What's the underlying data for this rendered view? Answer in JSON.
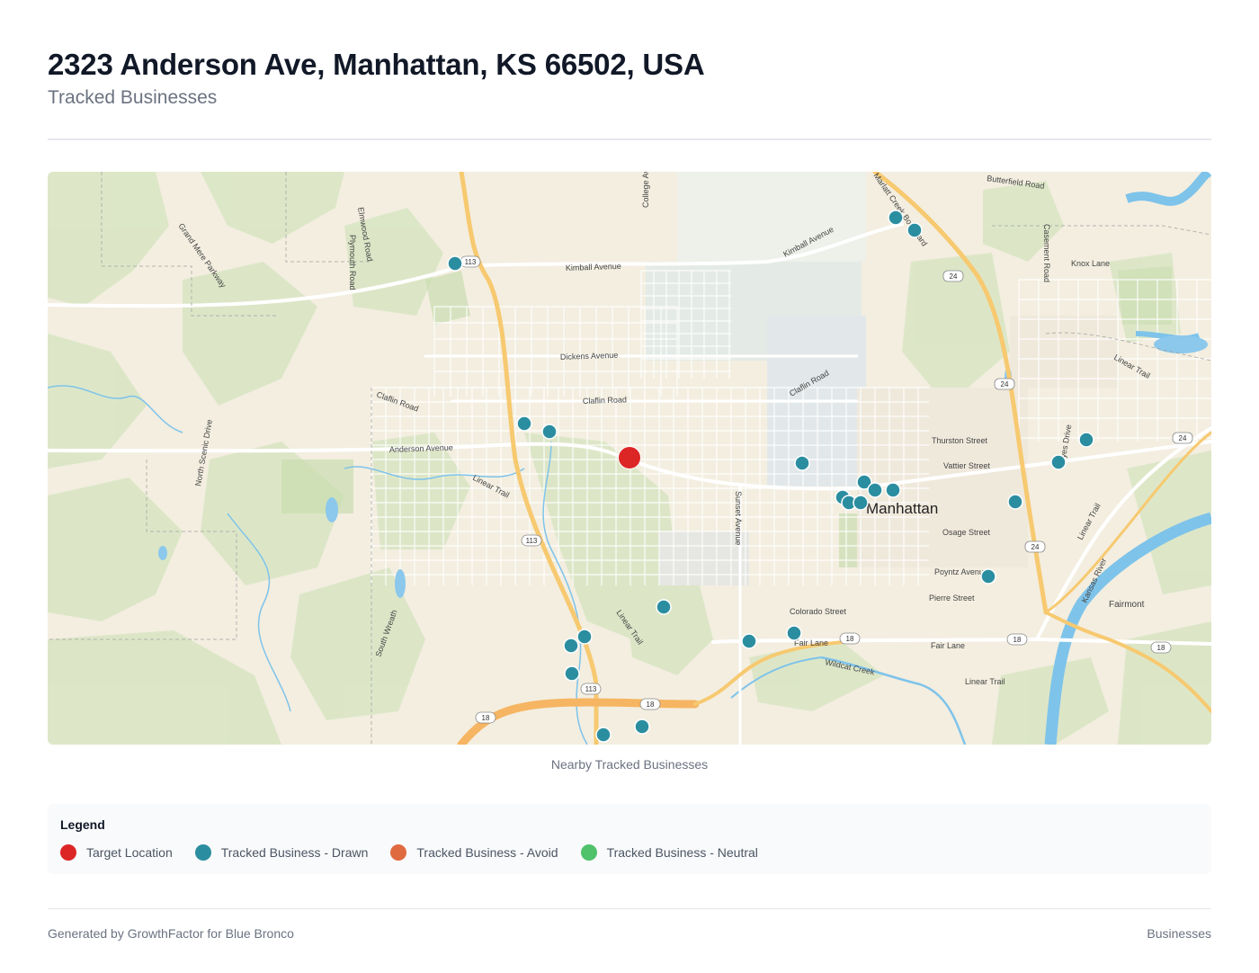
{
  "header": {
    "title": "2323 Anderson Ave, Manhattan, KS 66502, USA",
    "subtitle": "Tracked Businesses"
  },
  "map": {
    "caption": "Nearby Tracked Businesses",
    "city_label": "Manhattan",
    "town_labels": [
      "Fairmont"
    ],
    "street_labels": [
      "Kimball Avenue",
      "Kimball Avenue",
      "Dickens Avenue",
      "Claflin Road",
      "Claflin Road",
      "Claflin Road",
      "Anderson Avenue",
      "Linear Trail",
      "Linear Trail",
      "Linear Trail",
      "Linear Trail",
      "Linear Trail",
      "Thurston Street",
      "Vattier Street",
      "Osage Street",
      "Poyntz Avenue",
      "Pierre Street",
      "Colorado Street",
      "Fair Lane",
      "Fair Lane",
      "Wildcat Creek",
      "Kansas River",
      "Butterfield Road",
      "Casement Road",
      "Knox Lane",
      "Hayes Drive",
      "Sunset Avenue",
      "College Avenue",
      "Grand Mere Parkway",
      "Plymouth Road",
      "Elmwood Road",
      "North Scenic Drive",
      "South Wreath",
      "Marlatt Creek Boulevard"
    ],
    "route_shields": [
      "113",
      "113",
      "113",
      "24",
      "24",
      "24",
      "24",
      "18",
      "18",
      "18",
      "18",
      "18"
    ],
    "target": {
      "name": "Target Location",
      "color": "#dc2626"
    },
    "business_color": "#2b8ea0",
    "business_count": 30
  },
  "legend": {
    "title": "Legend",
    "items": [
      {
        "label": "Target Location",
        "color": "#dc2626"
      },
      {
        "label": "Tracked Business - Drawn",
        "color": "#2b8ea0"
      },
      {
        "label": "Tracked Business - Avoid",
        "color": "#e06a3f"
      },
      {
        "label": "Tracked Business - Neutral",
        "color": "#4fc26b"
      }
    ]
  },
  "footer": {
    "left": "Generated by GrowthFactor for Blue Bronco",
    "right": "Businesses"
  }
}
